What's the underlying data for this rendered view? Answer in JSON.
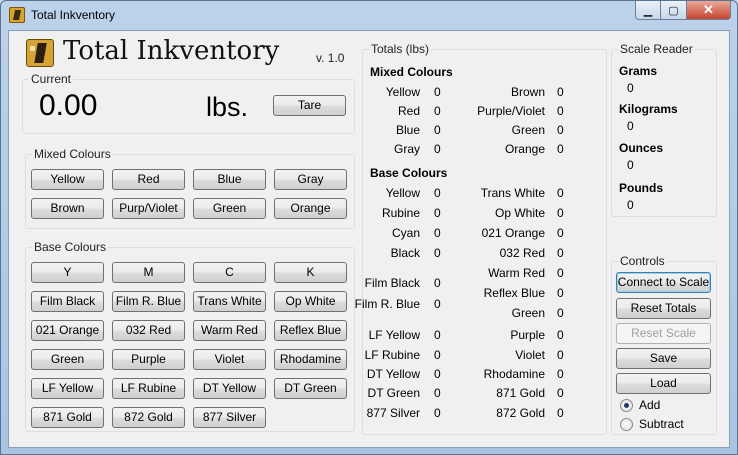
{
  "window": {
    "title": "Total Inkventory",
    "min_glyph": "▁",
    "max_glyph": "▢",
    "close_glyph": "✕"
  },
  "header": {
    "app_title": "Total Inkventory",
    "version": "v. 1.0"
  },
  "current": {
    "legend": "Current",
    "value": "0.00",
    "unit": "lbs.",
    "tare_label": "Tare"
  },
  "mixed_buttons": {
    "legend": "Mixed Colours",
    "rows": [
      [
        "Yellow",
        "Red",
        "Blue",
        "Gray"
      ],
      [
        "Brown",
        "Purp/Violet",
        "Green",
        "Orange"
      ]
    ]
  },
  "base_buttons": {
    "legend": "Base Colours",
    "rows": [
      [
        "Y",
        "M",
        "C",
        "K"
      ],
      [
        "Film Black",
        "Film R. Blue",
        "Trans White",
        "Op White"
      ],
      [
        "021 Orange",
        "032 Red",
        "Warm Red",
        "Reflex Blue"
      ],
      [
        "Green",
        "Purple",
        "Violet",
        "Rhodamine"
      ],
      [
        "LF Yellow",
        "LF Rubine",
        "DT Yellow",
        "DT Green"
      ],
      [
        "871 Gold",
        "872 Gold",
        "877 Silver"
      ]
    ]
  },
  "totals": {
    "legend": "Totals (lbs)",
    "mixed_heading": "Mixed Colours",
    "mixed_left": [
      {
        "label": "Yellow",
        "value": "0"
      },
      {
        "label": "Red",
        "value": "0"
      },
      {
        "label": "Blue",
        "value": "0"
      },
      {
        "label": "Gray",
        "value": "0"
      }
    ],
    "mixed_right": [
      {
        "label": "Brown",
        "value": "0"
      },
      {
        "label": "Purple/Violet",
        "value": "0"
      },
      {
        "label": "Green",
        "value": "0"
      },
      {
        "label": "Orange",
        "value": "0"
      }
    ],
    "base_heading": "Base Colours",
    "base_left": [
      {
        "label": "Yellow",
        "value": "0"
      },
      {
        "label": "Rubine",
        "value": "0"
      },
      {
        "label": "Cyan",
        "value": "0"
      },
      {
        "label": "Black",
        "value": "0"
      },
      {
        "label": "Film Black",
        "value": "0"
      },
      {
        "label": "Film R. Blue",
        "value": "0"
      },
      {
        "label": "LF Yellow",
        "value": "0"
      },
      {
        "label": "LF Rubine",
        "value": "0"
      },
      {
        "label": "DT Yellow",
        "value": "0"
      },
      {
        "label": "DT Green",
        "value": "0"
      },
      {
        "label": "877 Silver",
        "value": "0"
      }
    ],
    "base_right": [
      {
        "label": "Trans White",
        "value": "0"
      },
      {
        "label": "Op White",
        "value": "0"
      },
      {
        "label": "021 Orange",
        "value": "0"
      },
      {
        "label": "032 Red",
        "value": "0"
      },
      {
        "label": "Warm Red",
        "value": "0"
      },
      {
        "label": "Reflex Blue",
        "value": "0"
      },
      {
        "label": "Green",
        "value": "0"
      },
      {
        "label": "Purple",
        "value": "0"
      },
      {
        "label": "Violet",
        "value": "0"
      },
      {
        "label": "Rhodamine",
        "value": "0"
      },
      {
        "label": "871 Gold",
        "value": "0"
      },
      {
        "label": "872 Gold",
        "value": "0"
      }
    ]
  },
  "scale_reader": {
    "legend": "Scale Reader",
    "items": [
      {
        "label": "Grams",
        "value": "0"
      },
      {
        "label": "Kilograms",
        "value": "0"
      },
      {
        "label": "Ounces",
        "value": "0"
      },
      {
        "label": "Pounds",
        "value": "0"
      }
    ]
  },
  "controls": {
    "legend": "Controls",
    "connect": "Connect to Scale",
    "reset_totals": "Reset Totals",
    "reset_scale": "Reset Scale",
    "save": "Save",
    "load": "Load",
    "mode_add": "Add",
    "mode_subtract": "Subtract",
    "mode_selected": "Add"
  }
}
